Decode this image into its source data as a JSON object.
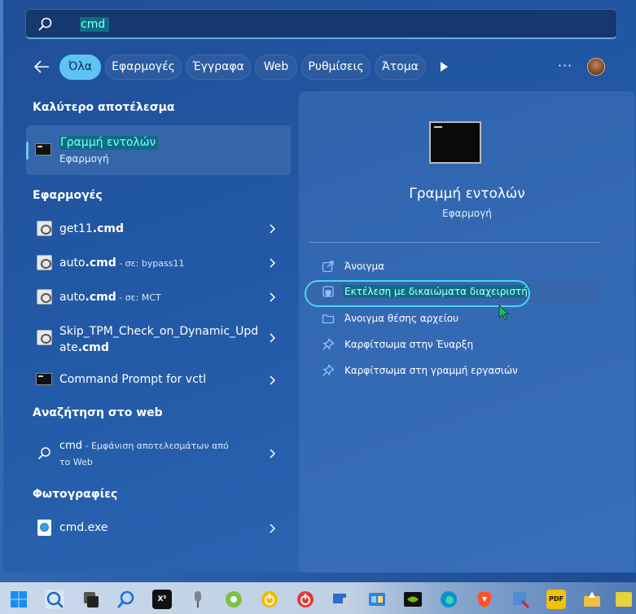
{
  "search": {
    "query": "cmd"
  },
  "filters": {
    "back_label": "",
    "chips": [
      {
        "label": "Όλα",
        "active": true
      },
      {
        "label": "Εφαρμογές",
        "active": false
      },
      {
        "label": "Έγγραφα",
        "active": false
      },
      {
        "label": "Web",
        "active": false
      },
      {
        "label": "Ρυθμίσεις",
        "active": false
      },
      {
        "label": "Άτομα",
        "active": false
      }
    ],
    "more_label": "···"
  },
  "best_match": {
    "section_title": "Καλύτερο αποτέλεσμα",
    "title": "Γραμμή εντολών",
    "subtitle": "Εφαρμογή"
  },
  "apps": {
    "section_title": "Εφαρμογές",
    "items": [
      {
        "name": "get11",
        "ext": ".cmd",
        "suffix": ""
      },
      {
        "name": "auto",
        "ext": ".cmd",
        "suffix": " - σε: bypass11"
      },
      {
        "name": "auto",
        "ext": ".cmd",
        "suffix": " - σε: MCT"
      },
      {
        "name": "Skip_TPM_Check_on_Dynamic_Upd",
        "name2": "ate",
        "ext": ".cmd",
        "suffix": ""
      },
      {
        "name": "Command Prompt for vctl",
        "ext": "",
        "suffix": ""
      }
    ]
  },
  "web": {
    "section_title": "Αναζήτηση στο web",
    "query": "cmd",
    "line1": " - Εμφάνιση αποτελεσμάτων από",
    "line2": "το Web"
  },
  "photos": {
    "section_title": "Φωτογραφίες",
    "item_name": "cmd",
    "item_ext": ".exe"
  },
  "detail": {
    "title": "Γραμμή εντολών",
    "subtitle": "Εφαρμογή",
    "actions": [
      {
        "label": "Άνοιγμα",
        "icon": "open-external-icon"
      },
      {
        "label": "Εκτέλεση με δικαιώματα διαχειριστή",
        "icon": "shield-admin-icon",
        "highlighted": true
      },
      {
        "label": "Άνοιγμα θέσης αρχείου",
        "icon": "folder-icon"
      },
      {
        "label": "Καρφίτσωμα στην Έναρξη",
        "icon": "pin-icon"
      },
      {
        "label": "Καρφίτσωμα στη γραμμή εργασιών",
        "icon": "pin-icon"
      }
    ]
  },
  "taskbar": {
    "x_app_label": "X⁵",
    "pdf_label": "PDF"
  },
  "colors": {
    "accent": "#5fc3f5",
    "selection": "#0d6d84",
    "highlight_ring": "#48d5f2"
  }
}
